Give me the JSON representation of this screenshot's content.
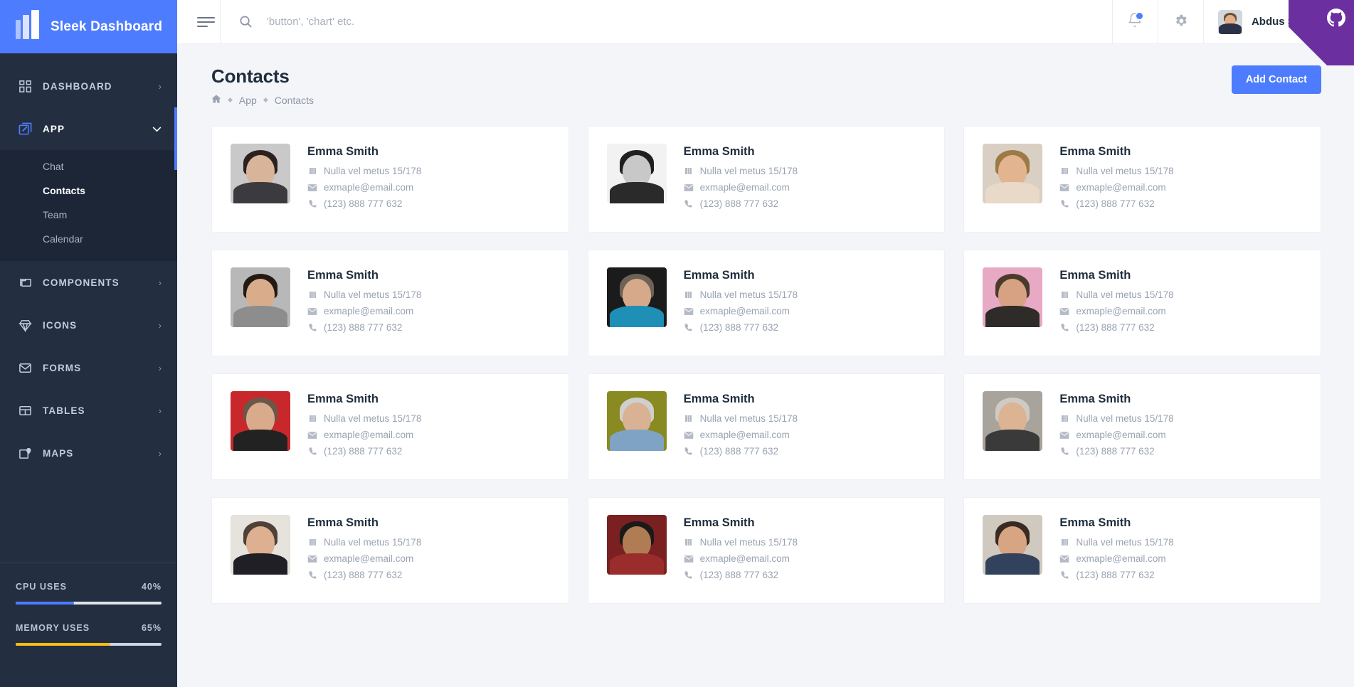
{
  "brand": {
    "title": "Sleek Dashboard",
    "logo_icon": "book-logo-icon",
    "accent": "#4d7cfe"
  },
  "sidebar": {
    "items": [
      {
        "label": "DASHBOARD",
        "icon": "grid-icon",
        "arrow": "›",
        "active": false
      },
      {
        "label": "APP",
        "icon": "edit-square-icon",
        "arrow": "⌄",
        "active": true
      },
      {
        "label": "COMPONENTS",
        "icon": "folder-icon",
        "arrow": "›",
        "active": false
      },
      {
        "label": "ICONS",
        "icon": "diamond-icon",
        "arrow": "›",
        "active": false
      },
      {
        "label": "FORMS",
        "icon": "envelope-icon",
        "arrow": "›",
        "active": false
      },
      {
        "label": "TABLES",
        "icon": "table-icon",
        "arrow": "›",
        "active": false
      },
      {
        "label": "MAPS",
        "icon": "map-pin-icon",
        "arrow": "›",
        "active": false
      }
    ],
    "submenu": [
      {
        "label": "Chat",
        "current": false
      },
      {
        "label": "Contacts",
        "current": true
      },
      {
        "label": "Team",
        "current": false
      },
      {
        "label": "Calendar",
        "current": false
      }
    ],
    "usage": [
      {
        "label": "CPU USES",
        "value": "40%",
        "percent": 40,
        "color": "#4d7cfe"
      },
      {
        "label": "MEMORY USES",
        "value": "65%",
        "percent": 65,
        "color": "#fbbc16"
      }
    ]
  },
  "topbar": {
    "menu_icon": "hamburger-icon",
    "search": {
      "icon": "search-icon",
      "placeholder": "'button', 'chart' etc.",
      "value": ""
    },
    "notifications": {
      "icon": "bell-icon",
      "has_unread": true
    },
    "settings": {
      "icon": "gear-icon"
    },
    "user": {
      "name": "Abdus Salam",
      "avatar": "user-avatar",
      "caret": "chevron-down-icon"
    },
    "github_corner": {
      "icon": "github-icon",
      "color": "#6b2fa0"
    }
  },
  "page": {
    "title": "Contacts",
    "breadcrumb": {
      "home_icon": "home-icon",
      "separator": "◆",
      "items": [
        "App",
        "Contacts"
      ]
    },
    "add_button": "Add Contact"
  },
  "contacts": [
    {
      "name": "Emma Smith",
      "address": "Nulla vel metus 15/178",
      "email": "exmaple@email.com",
      "phone": "(123) 888 777 632",
      "avatar": {
        "bg": "#c9c9c9",
        "skin": "#d8b49b",
        "hair": "#2c211c",
        "body": "#3b3b3f"
      }
    },
    {
      "name": "Emma Smith",
      "address": "Nulla vel metus 15/178",
      "email": "exmaple@email.com",
      "phone": "(123) 888 777 632",
      "avatar": {
        "bg": "#f2f2f2",
        "skin": "#c8c8c8",
        "hair": "#1f1f1f",
        "body": "#2a2a2a"
      }
    },
    {
      "name": "Emma Smith",
      "address": "Nulla vel metus 15/178",
      "email": "exmaple@email.com",
      "phone": "(123) 888 777 632",
      "avatar": {
        "bg": "#d9cfc2",
        "skin": "#e2b48f",
        "hair": "#9c7a45",
        "body": "#e8d9c8"
      }
    },
    {
      "name": "Emma Smith",
      "address": "Nulla vel metus 15/178",
      "email": "exmaple@email.com",
      "phone": "(123) 888 777 632",
      "avatar": {
        "bg": "#b8b8b8",
        "skin": "#d9ad8c",
        "hair": "#241a14",
        "body": "#8d8d8d"
      }
    },
    {
      "name": "Emma Smith",
      "address": "Nulla vel metus 15/178",
      "email": "exmaple@email.com",
      "phone": "(123) 888 777 632",
      "avatar": {
        "bg": "#1b1b1b",
        "skin": "#d6a98b",
        "hair": "#6d6257",
        "body": "#1e8fb5"
      }
    },
    {
      "name": "Emma Smith",
      "address": "Nulla vel metus 15/178",
      "email": "exmaple@email.com",
      "phone": "(123) 888 777 632",
      "avatar": {
        "bg": "#e7a9c4",
        "skin": "#d7a184",
        "hair": "#4a3a2c",
        "body": "#2f2b28"
      }
    },
    {
      "name": "Emma Smith",
      "address": "Nulla vel metus 15/178",
      "email": "exmaple@email.com",
      "phone": "(123) 888 777 632",
      "avatar": {
        "bg": "#c8282c",
        "skin": "#d9ab8c",
        "hair": "#6a5748",
        "body": "#222222"
      }
    },
    {
      "name": "Emma Smith",
      "address": "Nulla vel metus 15/178",
      "email": "exmaple@email.com",
      "phone": "(123) 888 777 632",
      "avatar": {
        "bg": "#8a8a22",
        "skin": "#d9b193",
        "hair": "#cfcfcf",
        "body": "#7fa3c4"
      }
    },
    {
      "name": "Emma Smith",
      "address": "Nulla vel metus 15/178",
      "email": "exmaple@email.com",
      "phone": "(123) 888 777 632",
      "avatar": {
        "bg": "#a8a49c",
        "skin": "#dcb494",
        "hair": "#cfcac3",
        "body": "#3a3a3a"
      }
    },
    {
      "name": "Emma Smith",
      "address": "Nulla vel metus 15/178",
      "email": "exmaple@email.com",
      "phone": "(123) 888 777 632",
      "avatar": {
        "bg": "#e6e2dc",
        "skin": "#dcb091",
        "hair": "#4f4038",
        "body": "#1f1f25"
      }
    },
    {
      "name": "Emma Smith",
      "address": "Nulla vel metus 15/178",
      "email": "exmaple@email.com",
      "phone": "(123) 888 777 632",
      "avatar": {
        "bg": "#7a2020",
        "skin": "#b07c54",
        "hair": "#1a1a1a",
        "body": "#9a2c2c"
      }
    },
    {
      "name": "Emma Smith",
      "address": "Nulla vel metus 15/178",
      "email": "exmaple@email.com",
      "phone": "(123) 888 777 632",
      "avatar": {
        "bg": "#cfc9bf",
        "skin": "#d7a583",
        "hair": "#3a2b22",
        "body": "#33425c"
      }
    }
  ],
  "icons": {
    "address": "map-marker-icon",
    "email": "envelope-icon",
    "phone": "phone-icon"
  }
}
